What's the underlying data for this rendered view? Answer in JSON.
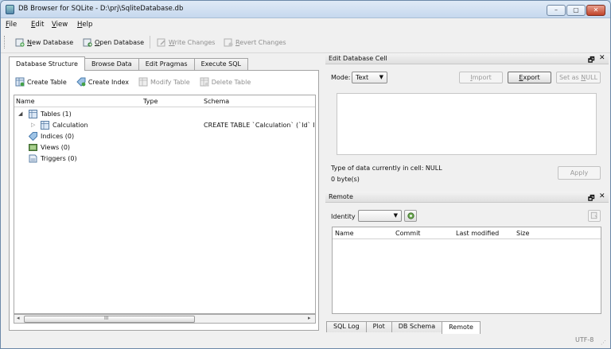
{
  "window": {
    "title": "DB Browser for SQLite - D:\\prj\\SqliteDatabase.db",
    "controls": {
      "minimize": "–",
      "maximize": "▢",
      "close": "✕"
    }
  },
  "menu": {
    "items": [
      {
        "underline": "F",
        "rest": "ile"
      },
      {
        "underline": "E",
        "rest": "dit"
      },
      {
        "underline": "V",
        "rest": "iew"
      },
      {
        "underline": "H",
        "rest": "elp"
      }
    ]
  },
  "toolbar": {
    "new_database": {
      "prefix": "",
      "underline": "N",
      "rest": "ew Database"
    },
    "open_database": {
      "prefix": "",
      "underline": "O",
      "rest": "pen Database"
    },
    "write_changes": {
      "prefix": "",
      "underline": "W",
      "rest": "rite Changes"
    },
    "revert_changes": {
      "prefix": "",
      "underline": "R",
      "rest": "evert Changes"
    }
  },
  "tabs": [
    "Database Structure",
    "Browse Data",
    "Edit Pragmas",
    "Execute SQL"
  ],
  "structure_toolbar": {
    "create_table": "Create Table",
    "create_index": "Create Index",
    "modify_table": "Modify Table",
    "delete_table": "Delete Table"
  },
  "tree": {
    "columns": [
      "Name",
      "Type",
      "Schema"
    ],
    "rows": [
      {
        "name": "Tables (1)",
        "type": "",
        "schema": ""
      },
      {
        "name": "Calculation",
        "type": "",
        "schema": "CREATE TABLE `Calculation` (`Id` IN"
      },
      {
        "name": "Indices (0)",
        "type": "",
        "schema": ""
      },
      {
        "name": "Views (0)",
        "type": "",
        "schema": ""
      },
      {
        "name": "Triggers (0)",
        "type": "",
        "schema": ""
      }
    ],
    "scroll_thumb_glyph": "III"
  },
  "edit_cell": {
    "title": "Edit Database Cell",
    "mode_label": "Mode:",
    "mode_value": "Text",
    "import": {
      "underline": "I",
      "rest": "mport",
      "prefix": ""
    },
    "export": {
      "underline": "E",
      "rest": "xport",
      "prefix": ""
    },
    "set_null": {
      "prefix": "Set as ",
      "underline": "N",
      "rest": "ULL"
    },
    "type_info": "Type of data currently in cell: NULL",
    "size_info": "0 byte(s)",
    "apply": "Apply"
  },
  "remote": {
    "title": "Remote",
    "identity_label": "Identity",
    "columns": [
      "Name",
      "Commit",
      "Last modified",
      "Size"
    ]
  },
  "bottom_tabs": [
    "SQL Log",
    "Plot",
    "DB Schema",
    "Remote"
  ],
  "status": {
    "encoding": "UTF-8"
  },
  "dock_controls": {
    "float": "🗗",
    "close": "✕"
  }
}
